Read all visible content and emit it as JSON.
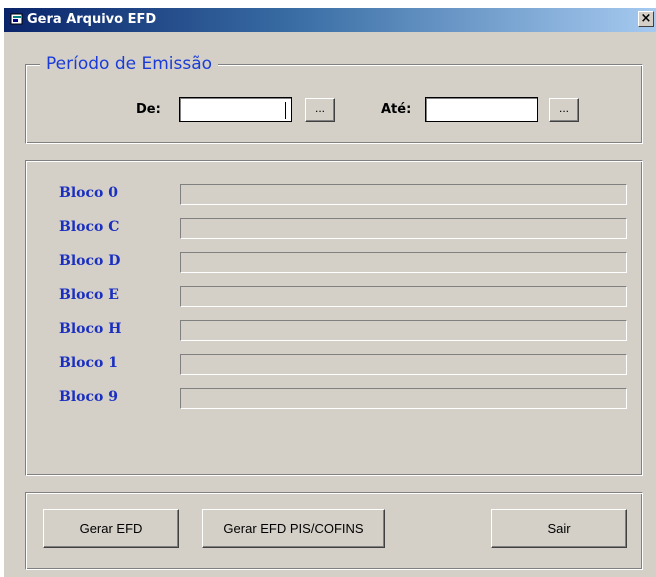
{
  "window": {
    "title": "Gera Arquivo EFD",
    "close_label": "×"
  },
  "periodo": {
    "legend": "Período de Emissão",
    "de_label": "De:",
    "de_value": "",
    "ate_label": "Até:",
    "ate_value": "",
    "browse_label": "..."
  },
  "blocos": [
    {
      "label": "Bloco 0",
      "progress": 0
    },
    {
      "label": "Bloco C",
      "progress": 0
    },
    {
      "label": "Bloco D",
      "progress": 0
    },
    {
      "label": "Bloco E",
      "progress": 0
    },
    {
      "label": "Bloco H",
      "progress": 0
    },
    {
      "label": "Bloco 1",
      "progress": 0
    },
    {
      "label": "Bloco 9",
      "progress": 0
    }
  ],
  "buttons": {
    "gerar_efd": "Gerar EFD",
    "gerar_pis": "Gerar EFD PIS/COFINS",
    "sair": "Sair"
  }
}
